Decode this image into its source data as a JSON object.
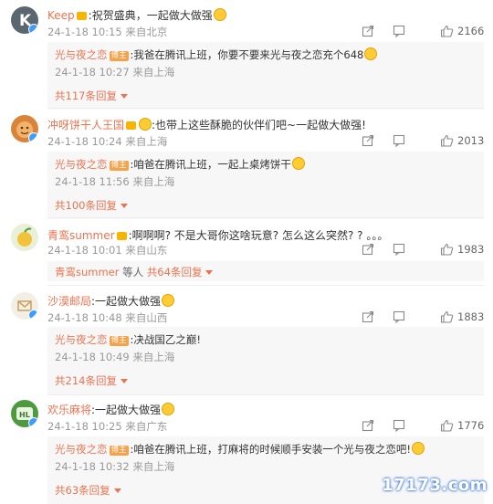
{
  "comments": [
    {
      "user": "Keep",
      "text": ":祝贺盛典，一起做大做强",
      "date": "24-1-18 10:15",
      "location": "来自北京",
      "likes": "2166",
      "reply": {
        "user": "光与夜之恋",
        "badge": "博主",
        "text": ":我爸在腾讯上班，你要不要来光与夜之恋充个648",
        "date": "24-1-18 10:27",
        "location": "来自上海"
      },
      "more": "共117条回复"
    },
    {
      "user": "冲呀饼干人王国",
      "text": ":也带上这些酥脆的伙伴们吧~一起做大做强!",
      "date": "24-1-18 10:24",
      "location": "来自上海",
      "likes": "2013",
      "reply": {
        "user": "光与夜之恋",
        "badge": "博主",
        "text": ":咱爸在腾讯上班，一起上桌烤饼干",
        "date": "24-1-18 11:56",
        "location": "来自上海"
      },
      "more": "共100条回复"
    },
    {
      "user": "青鸾summer",
      "text": ":啊啊啊? 不是大哥你这啥玩意? 怎么这么突然? ? 。。。",
      "date": "24-1-18 10:01",
      "location": "来自山东",
      "likes": "1983",
      "more_user": "青鸾summer",
      "more_mid": " 等人 ",
      "more": "共64条回复"
    },
    {
      "user": "沙漠邮局",
      "text": ":一起做大做强",
      "date": "24-1-18 10:48",
      "location": "来自山西",
      "likes": "1883",
      "reply": {
        "user": "光与夜之恋",
        "badge": "博主",
        "text": ":决战国乙之巅!",
        "date": "24-1-18 10:49",
        "location": "来自上海"
      },
      "more": "共214条回复"
    },
    {
      "user": "欢乐麻将",
      "text": ":一起做大做强",
      "date": "24-1-18 10:25",
      "location": "来自广东",
      "likes": "1776",
      "reply": {
        "user": "光与夜之恋",
        "badge": "博主",
        "text": ":咱爸在腾讯上班，打麻将的时候顺手安装一个光与夜之恋吧!",
        "date": "24-1-18 10:32",
        "location": "来自上海"
      },
      "more": "共63条回复"
    }
  ],
  "watermark": "17173.com",
  "icons": {
    "share": "share-icon",
    "comment": "comment-icon",
    "like": "like-icon"
  },
  "colors": {
    "username": "#eb7350",
    "verified": "#3e9bff",
    "badge": "#f6a24a"
  }
}
